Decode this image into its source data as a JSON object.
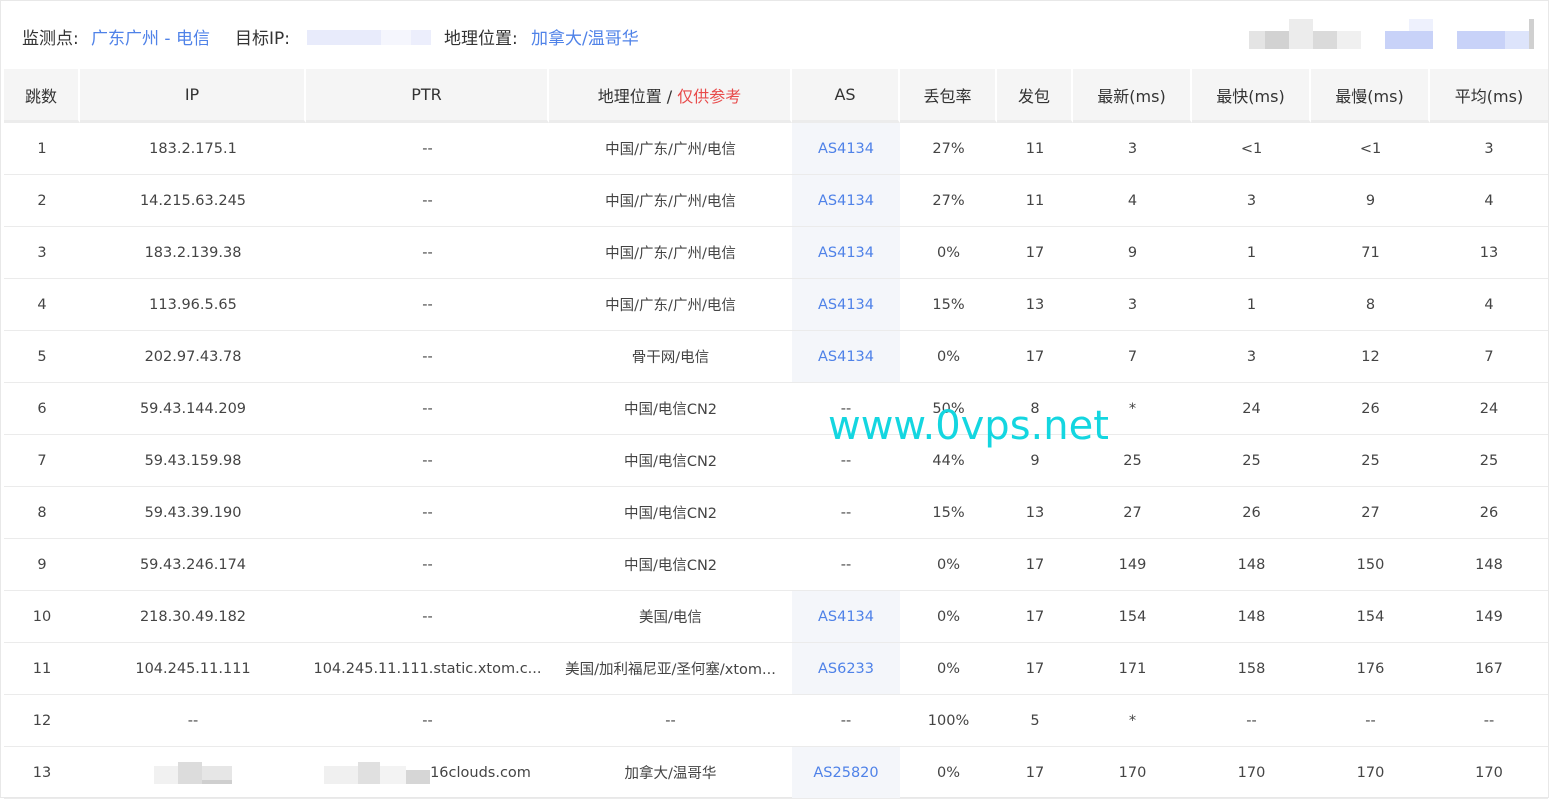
{
  "header": {
    "monitor_label": "监测点:",
    "monitor_value": "广东广州 - 电信",
    "target_ip_label": "目标IP:",
    "geo_label": "地理位置:",
    "geo_value": "加拿大/温哥华"
  },
  "table": {
    "columns": {
      "hop": "跳数",
      "ip": "IP",
      "ptr": "PTR",
      "geo": "地理位置 / ",
      "geo_note": "仅供参考",
      "as": "AS",
      "loss": "丢包率",
      "sent": "发包",
      "last": "最新(ms)",
      "best": "最快(ms)",
      "worst": "最慢(ms)",
      "avg": "平均(ms)"
    },
    "rows": [
      {
        "hop": "1",
        "ip": "183.2.175.1",
        "ptr": "--",
        "geo": "中国/广东/广州/电信",
        "as": "AS4134",
        "loss": "27%",
        "sent": "11",
        "last": "3",
        "best": "<1",
        "worst": "<1",
        "avg": "3"
      },
      {
        "hop": "2",
        "ip": "14.215.63.245",
        "ptr": "--",
        "geo": "中国/广东/广州/电信",
        "as": "AS4134",
        "loss": "27%",
        "sent": "11",
        "last": "4",
        "best": "3",
        "worst": "9",
        "avg": "4"
      },
      {
        "hop": "3",
        "ip": "183.2.139.38",
        "ptr": "--",
        "geo": "中国/广东/广州/电信",
        "as": "AS4134",
        "loss": "0%",
        "sent": "17",
        "last": "9",
        "best": "1",
        "worst": "71",
        "avg": "13"
      },
      {
        "hop": "4",
        "ip": "113.96.5.65",
        "ptr": "--",
        "geo": "中国/广东/广州/电信",
        "as": "AS4134",
        "loss": "15%",
        "sent": "13",
        "last": "3",
        "best": "1",
        "worst": "8",
        "avg": "4"
      },
      {
        "hop": "5",
        "ip": "202.97.43.78",
        "ptr": "--",
        "geo": "骨干网/电信",
        "as": "AS4134",
        "loss": "0%",
        "sent": "17",
        "last": "7",
        "best": "3",
        "worst": "12",
        "avg": "7"
      },
      {
        "hop": "6",
        "ip": "59.43.144.209",
        "ptr": "--",
        "geo": "中国/电信CN2",
        "as": "--",
        "loss": "50%",
        "sent": "8",
        "last": "*",
        "best": "24",
        "worst": "26",
        "avg": "24"
      },
      {
        "hop": "7",
        "ip": "59.43.159.98",
        "ptr": "--",
        "geo": "中国/电信CN2",
        "as": "--",
        "loss": "44%",
        "sent": "9",
        "last": "25",
        "best": "25",
        "worst": "25",
        "avg": "25"
      },
      {
        "hop": "8",
        "ip": "59.43.39.190",
        "ptr": "--",
        "geo": "中国/电信CN2",
        "as": "--",
        "loss": "15%",
        "sent": "13",
        "last": "27",
        "best": "26",
        "worst": "27",
        "avg": "26"
      },
      {
        "hop": "9",
        "ip": "59.43.246.174",
        "ptr": "--",
        "geo": "中国/电信CN2",
        "as": "--",
        "loss": "0%",
        "sent": "17",
        "last": "149",
        "best": "148",
        "worst": "150",
        "avg": "148"
      },
      {
        "hop": "10",
        "ip": "218.30.49.182",
        "ptr": "--",
        "geo": "美国/电信",
        "as": "AS4134",
        "loss": "0%",
        "sent": "17",
        "last": "154",
        "best": "148",
        "worst": "154",
        "avg": "149"
      },
      {
        "hop": "11",
        "ip": "104.245.11.111",
        "ptr": "104.245.11.111.static.xtom.c...",
        "geo": "美国/加利福尼亚/圣何塞/xtom...",
        "as": "AS6233",
        "loss": "0%",
        "sent": "17",
        "last": "171",
        "best": "158",
        "worst": "176",
        "avg": "167"
      },
      {
        "hop": "12",
        "ip": "--",
        "ptr": "--",
        "geo": "--",
        "as": "--",
        "loss": "100%",
        "sent": "5",
        "last": "*",
        "best": "--",
        "worst": "--",
        "avg": "--"
      },
      {
        "hop": "13",
        "ip": "",
        "ptr": "16clouds.com",
        "geo": "加拿大/温哥华",
        "as": "AS25820",
        "loss": "0%",
        "sent": "17",
        "last": "170",
        "best": "170",
        "worst": "170",
        "avg": "170"
      }
    ]
  },
  "watermark": "www.0vps.net",
  "colors": {
    "link": "#4f82e8",
    "note_red": "#e84a4a",
    "watermark": "#14d6e0",
    "header_bg": "#f5f5f5"
  }
}
